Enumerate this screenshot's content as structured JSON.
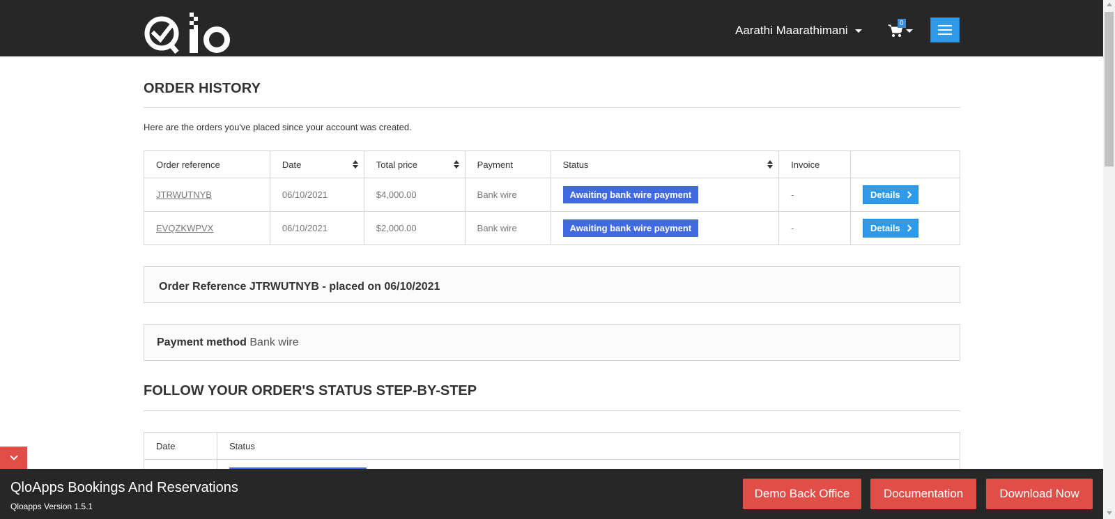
{
  "header": {
    "logo_text": "Qlo",
    "user_name": "Aarathi Maarathimani",
    "cart_count": "0"
  },
  "main": {
    "heading": "ORDER HISTORY",
    "intro": "Here are the orders you've placed since your account was created.",
    "table": {
      "columns": [
        "Order reference",
        "Date",
        "Total price",
        "Payment",
        "Status",
        "Invoice",
        ""
      ],
      "rows": [
        {
          "reference": "JTRWUTNYB",
          "date": "06/10/2021",
          "total": "$4,000.00",
          "payment": "Bank wire",
          "status": "Awaiting bank wire payment",
          "invoice": "-",
          "action": "Details"
        },
        {
          "reference": "EVQZKWPVX",
          "date": "06/10/2021",
          "total": "$2,000.00",
          "payment": "Bank wire",
          "status": "Awaiting bank wire payment",
          "invoice": "-",
          "action": "Details"
        }
      ]
    },
    "order_reference_box": "Order Reference JTRWUTNYB - placed on 06/10/2021",
    "payment_method_label": "Payment method",
    "payment_method_value": "Bank wire",
    "follow_heading": "FOLLOW YOUR ORDER'S STATUS STEP-BY-STEP",
    "history_table": {
      "columns": [
        "Date",
        "Status"
      ]
    }
  },
  "footer": {
    "title": "QloApps Bookings And Reservations",
    "version": "Qloapps Version 1.5.1",
    "buttons": [
      "Demo Back Office",
      "Documentation",
      "Download Now"
    ]
  },
  "colors": {
    "header_bg": "#272727",
    "accent_blue": "#2e9ae8",
    "status_blue": "#4169e1",
    "footer_button": "#e04e47"
  }
}
